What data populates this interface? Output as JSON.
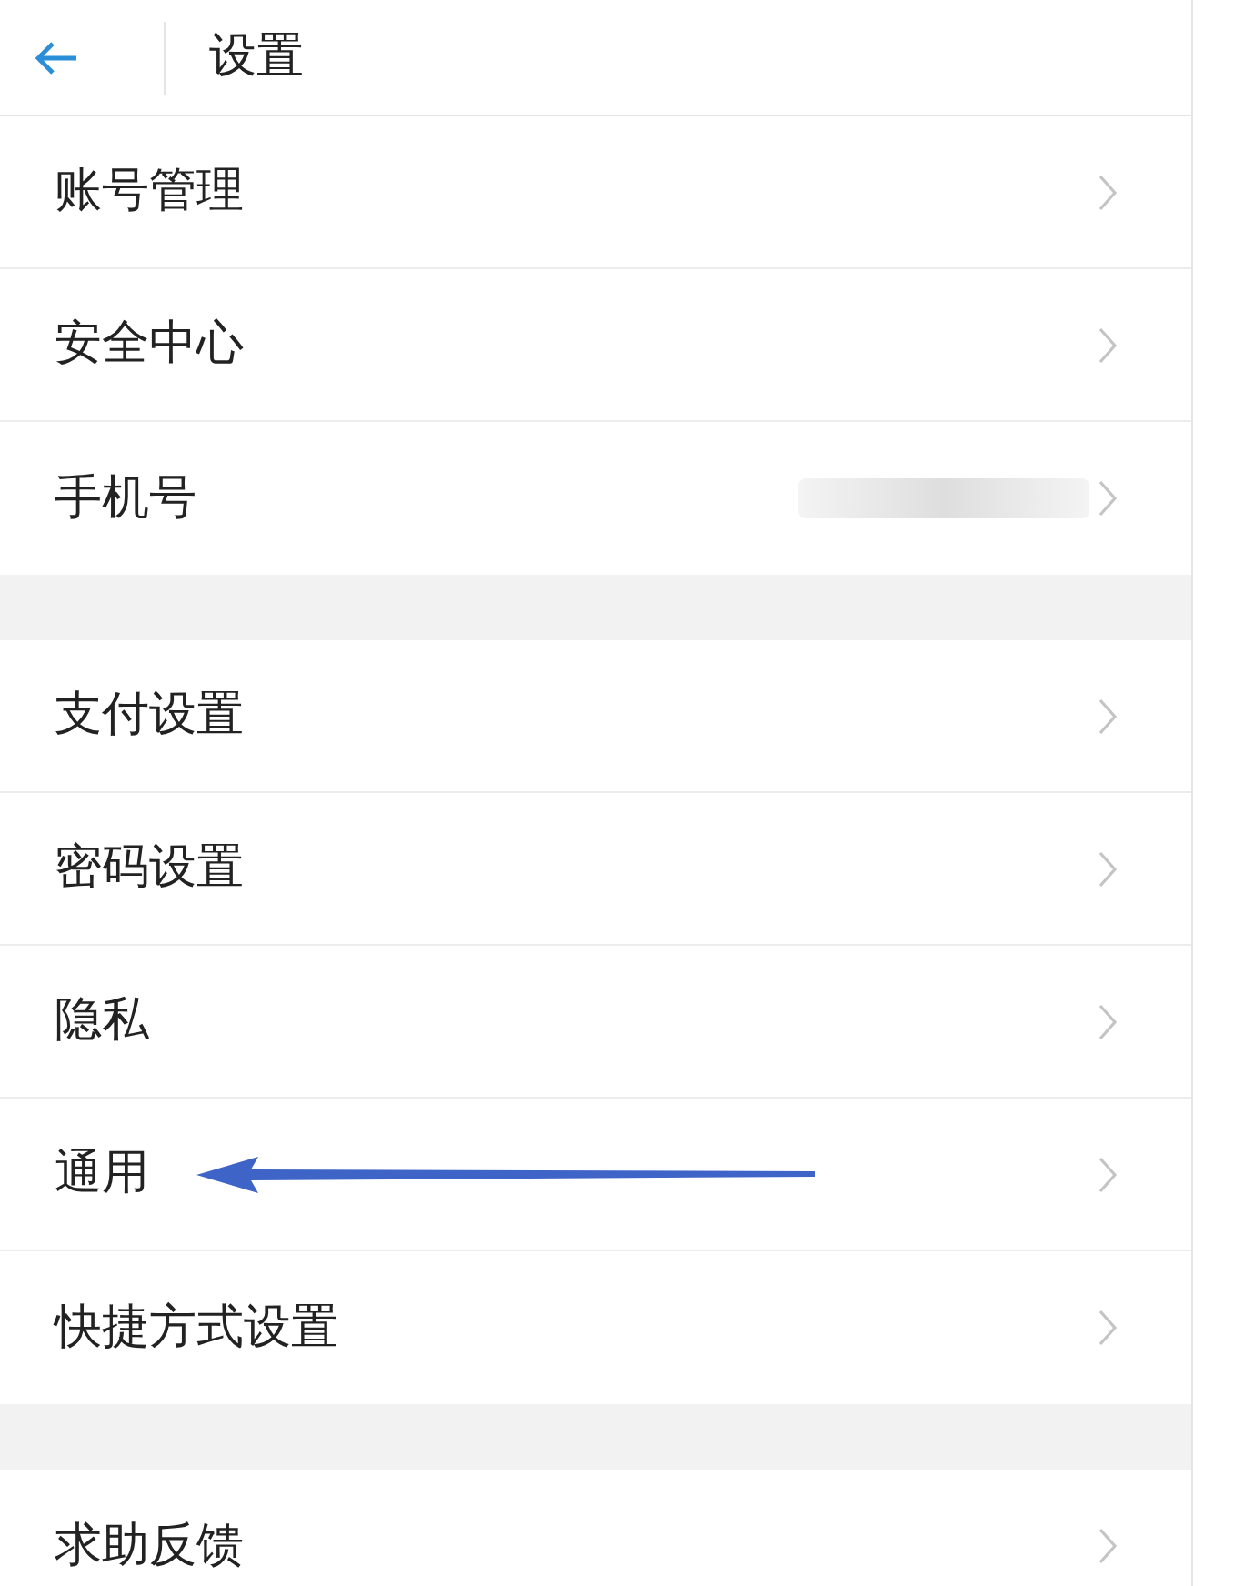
{
  "header": {
    "title": "设置"
  },
  "groups": [
    [
      {
        "label": "账号管理",
        "kind": "link",
        "marked": false
      },
      {
        "label": "安全中心",
        "kind": "link",
        "marked": false
      },
      {
        "label": "手机号",
        "kind": "hidden-value",
        "marked": false
      }
    ],
    [
      {
        "label": "支付设置",
        "kind": "link",
        "marked": false
      },
      {
        "label": "密码设置",
        "kind": "link",
        "marked": false
      },
      {
        "label": "隐私",
        "kind": "link",
        "marked": false
      },
      {
        "label": "通用",
        "kind": "link",
        "marked": true
      },
      {
        "label": "快捷方式设置",
        "kind": "link",
        "marked": false
      }
    ],
    [
      {
        "label": "求助反馈",
        "kind": "link",
        "marked": false
      }
    ]
  ]
}
